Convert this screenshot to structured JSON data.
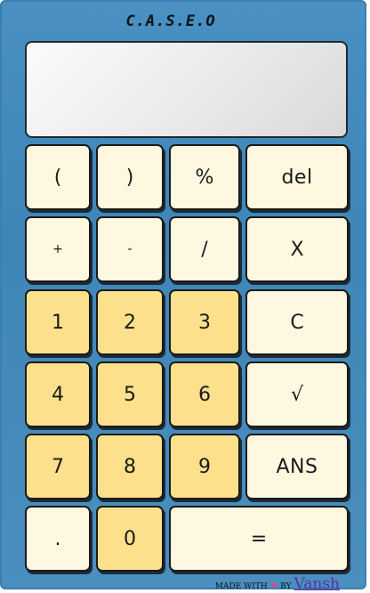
{
  "brand": "C.A.S.E.O",
  "display": {
    "value": ""
  },
  "keys": {
    "open_paren": "(",
    "close_paren": ")",
    "percent": "%",
    "delete": "del",
    "plus": "+",
    "minus": "-",
    "divide": "/",
    "multiply": "X",
    "one": "1",
    "two": "2",
    "three": "3",
    "clear": "C",
    "four": "4",
    "five": "5",
    "six": "6",
    "sqrt": "√",
    "seven": "7",
    "eight": "8",
    "nine": "9",
    "ans": "ANS",
    "dot": ".",
    "zero": "0",
    "equals": "="
  },
  "footer": {
    "made_with": "MADE WITH",
    "heart_icon": "heart-icon",
    "by": "BY",
    "author": "Vansh"
  },
  "colors": {
    "body": "#4a90c2",
    "key_light": "#fff8e1",
    "key_number": "#fde08c",
    "display": "#eeeeee"
  }
}
